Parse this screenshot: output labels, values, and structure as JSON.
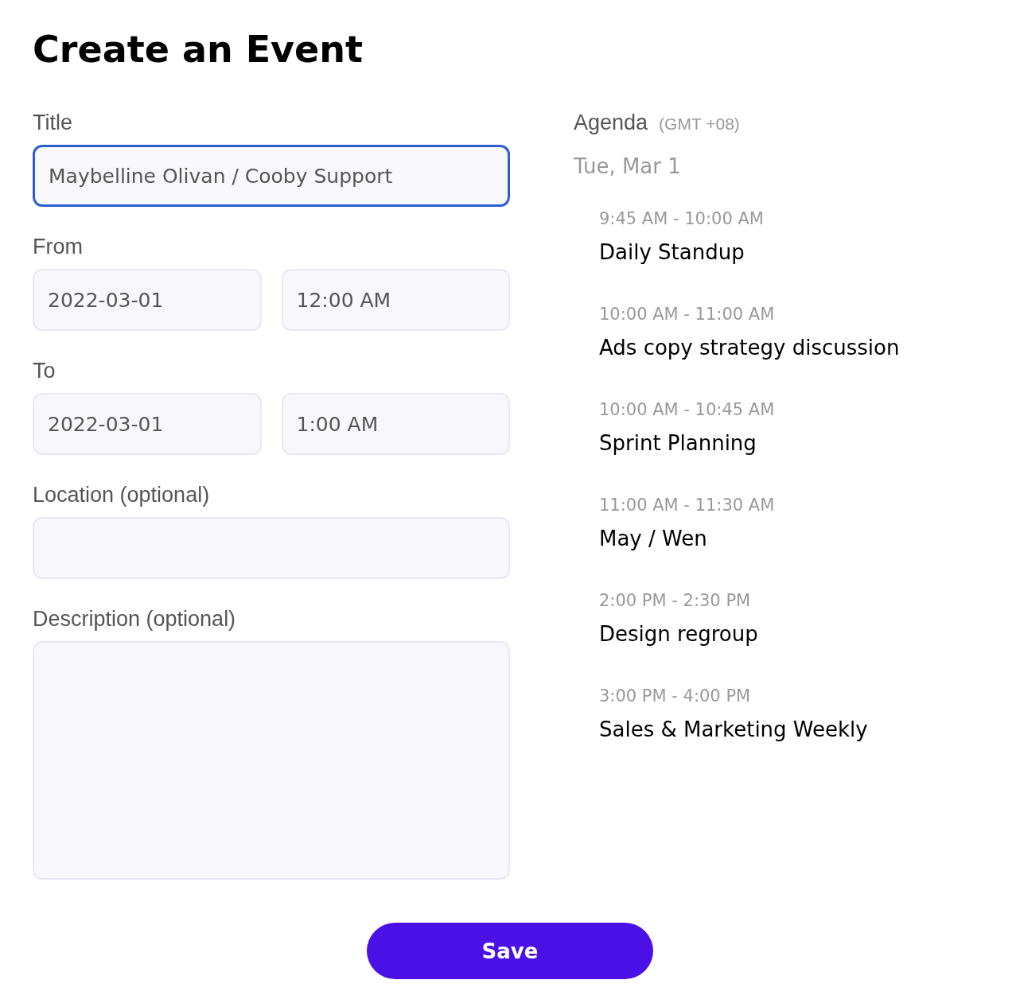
{
  "heading": "Create an Event",
  "form": {
    "title": {
      "label": "Title",
      "value": "Maybelline Olivan / Cooby Support",
      "focused": true
    },
    "from": {
      "label": "From",
      "date": "2022-03-01",
      "time": "12:00 AM"
    },
    "to": {
      "label": "To",
      "date": "2022-03-01",
      "time": "1:00 AM"
    },
    "location": {
      "label": "Location (optional)"
    },
    "description": {
      "label": "Description (optional)"
    }
  },
  "agenda": {
    "label": "Agenda",
    "timezone": "(GMT +08)",
    "date": "Tue, Mar 1",
    "events": [
      {
        "time": "9:45 AM - 10:00 AM",
        "title": "Daily Standup"
      },
      {
        "time": "10:00 AM - 11:00 AM",
        "title": "Ads copy strategy discussion"
      },
      {
        "time": "10:00 AM - 10:45 AM",
        "title": "Sprint Planning"
      },
      {
        "time": "11:00 AM - 11:30 AM",
        "title": "May / Wen"
      },
      {
        "time": "2:00 PM - 2:30 PM",
        "title": "Design regroup"
      },
      {
        "time": "3:00 PM - 4:00 PM",
        "title": "Sales & Marketing Weekly"
      }
    ]
  },
  "save_button": "Save"
}
